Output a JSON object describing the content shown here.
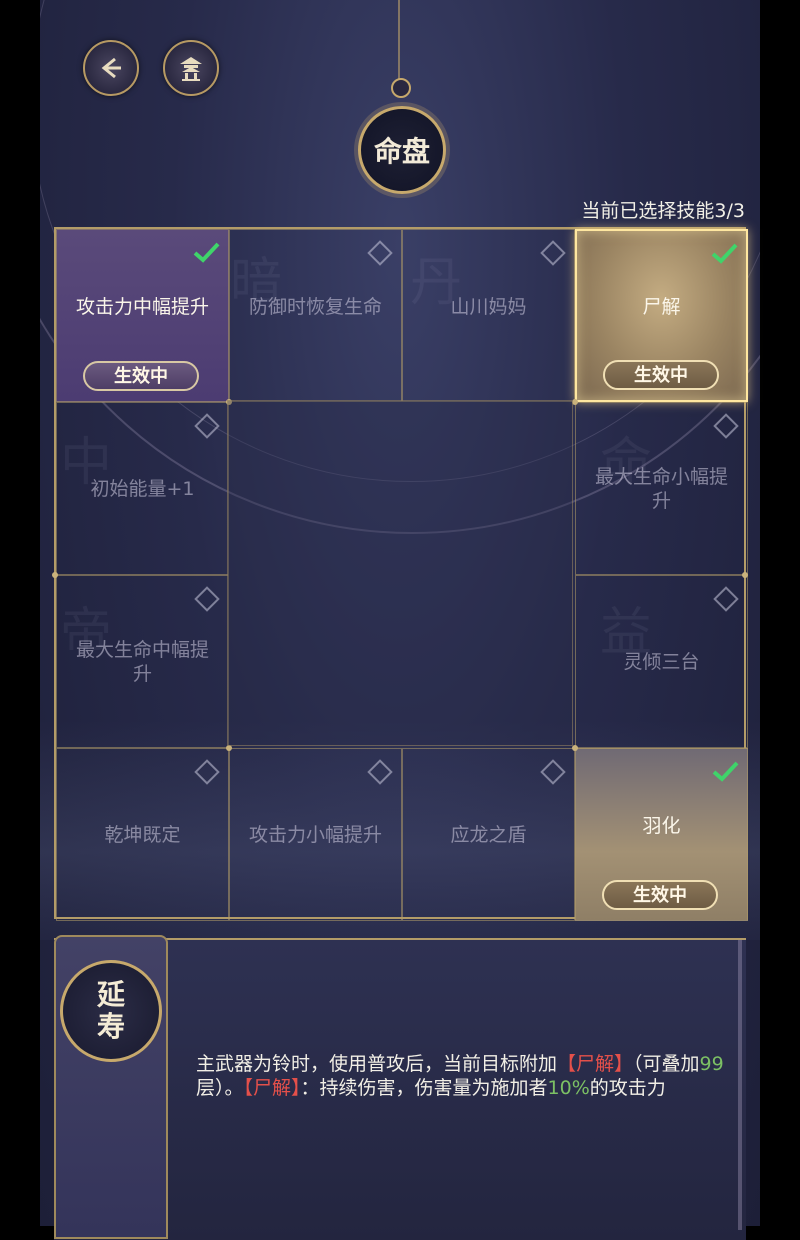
{
  "header": {
    "title": "命盘",
    "selection_status": "当前已选择技能3/3"
  },
  "colors": {
    "gold_border": "#b39c68",
    "active_purple": "#4c3c72",
    "active_gold": "#c4ac82",
    "check_green": "#3fd46a",
    "highlight_red": "#e4504a",
    "highlight_green": "#7cc064"
  },
  "skills": [
    {
      "label": "攻击力中幅提升",
      "selected": true,
      "badge": "生效中"
    },
    {
      "label": "防御时恢复生命",
      "selected": false
    },
    {
      "label": "山川妈妈",
      "selected": false
    },
    {
      "label": "尸解",
      "selected": true,
      "badge": "生效中"
    },
    {
      "label": "初始能量+1",
      "selected": false
    },
    {
      "label": "最大生命小幅提升",
      "selected": false
    },
    {
      "label": "最大生命中幅提升",
      "selected": false
    },
    {
      "label": "灵倾三台",
      "selected": false
    },
    {
      "label": "乾坤既定",
      "selected": false
    },
    {
      "label": "攻击力小幅提升",
      "selected": false
    },
    {
      "label": "应龙之盾",
      "selected": false
    },
    {
      "label": "羽化",
      "selected": true,
      "badge": "生效中"
    }
  ],
  "detail": {
    "seal_line1": "延",
    "seal_line2": "寿",
    "desc_part1": "主武器为铃时，使用普攻后，当前目标附加",
    "desc_tag1": "【尸解】",
    "desc_part2": "（可叠加",
    "desc_stack": "99",
    "desc_part3": "层）。",
    "desc_tag2": "【尸解】",
    "desc_part4": "：持续伤害，伤害量为施加者",
    "desc_pct": "10%",
    "desc_part5": "的攻击力"
  },
  "icons": {
    "back": "back-arrow-icon",
    "home": "pavilion-icon",
    "check": "checkmark-icon",
    "unselected": "diamond-icon"
  }
}
